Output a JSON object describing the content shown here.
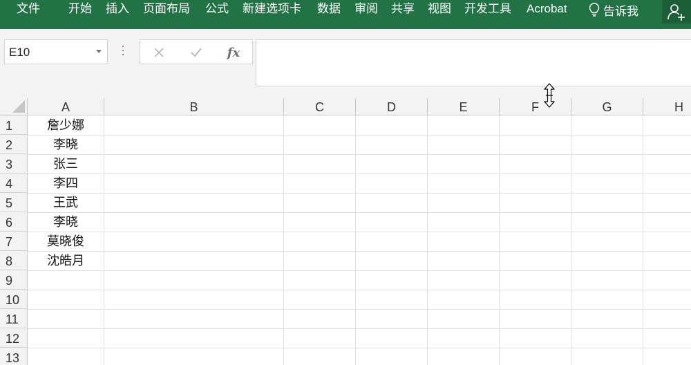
{
  "ribbon": {
    "tabs": [
      "文件",
      "开始",
      "插入",
      "页面布局",
      "公式",
      "新建选项卡",
      "数据",
      "审阅",
      "共享",
      "视图",
      "开发工具",
      "Acrobat"
    ],
    "tell_me": "告诉我",
    "accent_color": "#217346"
  },
  "formula_bar": {
    "name_box": "E10",
    "cancel_icon": "close-icon",
    "enter_icon": "check-icon",
    "function_label": "fx",
    "formula_value": ""
  },
  "sheet": {
    "columns": [
      "A",
      "B",
      "C",
      "D",
      "E",
      "F",
      "G",
      "H"
    ],
    "rows": [
      "1",
      "2",
      "3",
      "4",
      "5",
      "6",
      "7",
      "8",
      "9",
      "10",
      "11",
      "12",
      "13"
    ],
    "column_a": [
      "詹少娜",
      "李晓",
      "张三",
      "李四",
      "王武",
      "李晓",
      "莫晓俊",
      "沈皓月",
      "",
      "",
      "",
      "",
      ""
    ]
  }
}
